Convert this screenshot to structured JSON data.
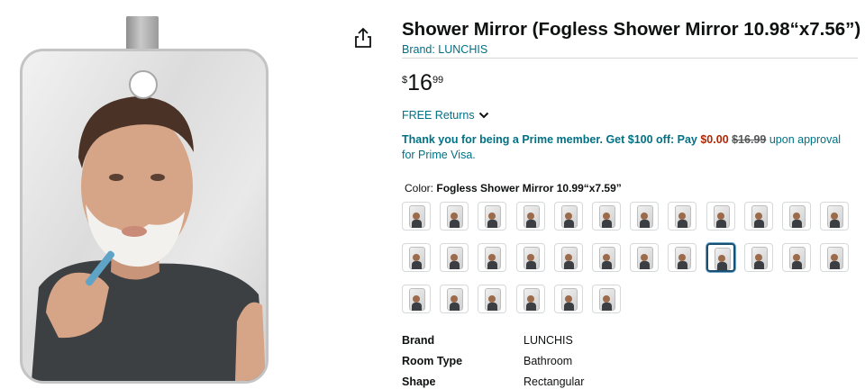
{
  "product": {
    "title": "Shower Mirror (Fogless Shower Mirror 10.98“x7.56”)",
    "brand_link": "Brand: LUNCHIS",
    "price": {
      "symbol": "$",
      "whole": "16",
      "fraction": "99"
    },
    "returns": "FREE Returns",
    "prime_offer": {
      "lead": "Thank you for being a Prime member. Get $100 off: Pay",
      "pay": "$0.00",
      "was": "$16.99",
      "tail": "upon approval for Prime Visa."
    },
    "color": {
      "label": "Color:",
      "value": "Fogless Shower Mirror 10.99“x7.59”"
    },
    "swatch_rows": [
      12,
      12,
      6
    ],
    "selected_swatch": 20,
    "specs": [
      {
        "key": "Brand",
        "value": "LUNCHIS"
      },
      {
        "key": "Room Type",
        "value": "Bathroom"
      },
      {
        "key": "Shape",
        "value": "Rectangular"
      }
    ]
  },
  "icons": {
    "share": "share-icon",
    "returns_chevron": "chevron-down-icon"
  }
}
